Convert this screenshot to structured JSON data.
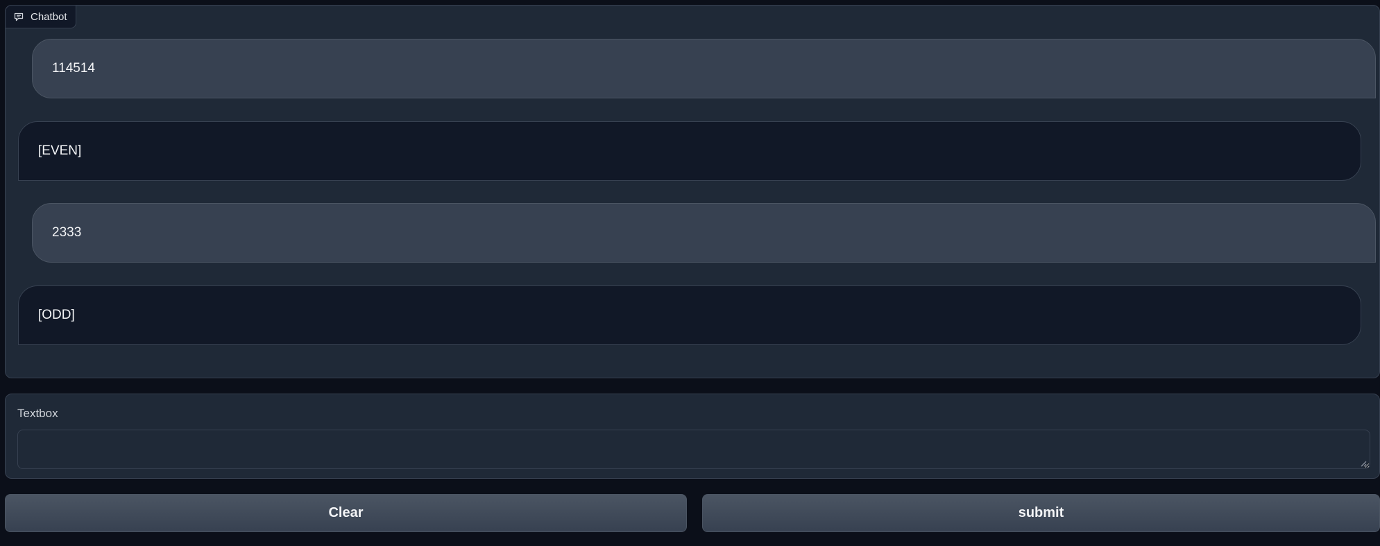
{
  "chatbot": {
    "label": "Chatbot",
    "icon": "chat-icon",
    "messages": [
      {
        "role": "user",
        "text": "114514"
      },
      {
        "role": "bot",
        "text": "[EVEN]"
      },
      {
        "role": "user",
        "text": "2333"
      },
      {
        "role": "bot",
        "text": "[ODD]"
      }
    ]
  },
  "textbox": {
    "label": "Textbox",
    "value": "",
    "placeholder": ""
  },
  "buttons": {
    "clear_label": "Clear",
    "submit_label": "submit"
  },
  "colors": {
    "page_bg": "#0b0f19",
    "panel_bg": "#1f2937",
    "user_bubble": "#374151",
    "bot_bubble": "#111827",
    "border": "#374151"
  }
}
